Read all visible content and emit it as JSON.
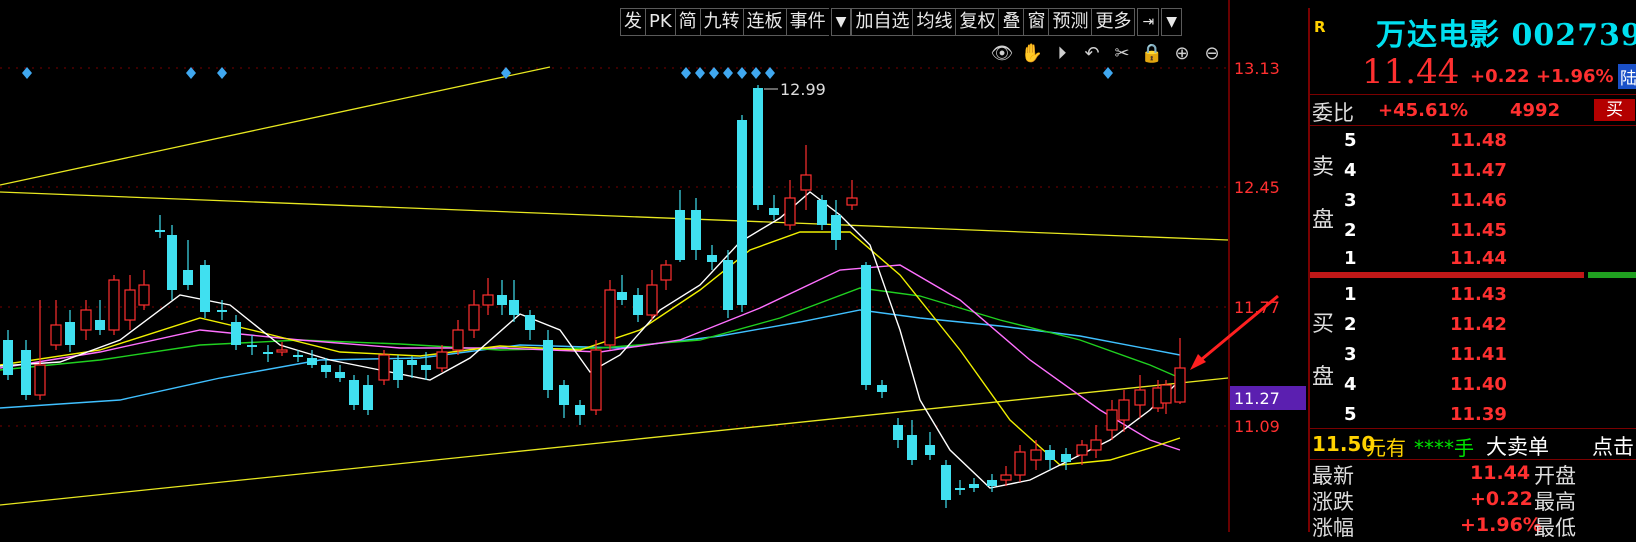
{
  "toolbar": {
    "items": [
      "发",
      "PK",
      "简",
      "九转",
      "连板",
      "事件",
      "加自选",
      "均线",
      "复权",
      "叠",
      "窗",
      "预测",
      "更多"
    ],
    "dropdown_icon": "caret-down-icon",
    "pin_icon": "pin-arrow-icon"
  },
  "chart_tools": [
    "eye-icon",
    "hand-icon",
    "play-icon",
    "undo-icon",
    "scissors-icon",
    "lock-icon",
    "zoom-in-icon",
    "zoom-out-icon"
  ],
  "chart": {
    "y_ticks": [
      "13.13",
      "12.45",
      "11.77",
      "11.09"
    ],
    "current_price_tag": "11.27",
    "high_annotation": "12.99",
    "colors": {
      "up": "#ff3030",
      "down": "#40e0f0",
      "ma5": "#ffffff",
      "ma10": "#f0f000",
      "ma20": "#ff70ff",
      "ma30": "#20d020",
      "ma60": "#40c0ff",
      "trend": "#e8e820",
      "price_tag_bg": "#5b1fb0"
    }
  },
  "panel": {
    "badge": "R",
    "stock_name": "万达电影 002739",
    "last_price": "11.44",
    "change": "+0.22",
    "change_pct": "+1.96%",
    "market_tag": "陆",
    "weibi_label": "委比",
    "weibi_value": "+45.61%",
    "weibi_diff": "4992",
    "buy_label": "买",
    "sell_side_label": [
      "卖",
      "盘"
    ],
    "buy_side_label": [
      "买",
      "盘"
    ],
    "sell_levels": [
      {
        "num": "5",
        "price": "11.48"
      },
      {
        "num": "4",
        "price": "11.47"
      },
      {
        "num": "3",
        "price": "11.46"
      },
      {
        "num": "2",
        "price": "11.45"
      },
      {
        "num": "1",
        "price": "11.44"
      }
    ],
    "buy_levels": [
      {
        "num": "1",
        "price": "11.43"
      },
      {
        "num": "2",
        "price": "11.42"
      },
      {
        "num": "3",
        "price": "11.41"
      },
      {
        "num": "4",
        "price": "11.40"
      },
      {
        "num": "5",
        "price": "11.39"
      }
    ],
    "big_order": {
      "price": "11.50",
      "you": "元有",
      "qty": "****手",
      "type": "大卖单",
      "click": "点击"
    },
    "stats": [
      {
        "label": "最新",
        "value": "11.44",
        "label2": "开盘"
      },
      {
        "label": "涨跌",
        "value": "+0.22",
        "label2": "最高"
      },
      {
        "label": "涨幅",
        "value": "+1.96%",
        "label2": "最低"
      }
    ]
  }
}
